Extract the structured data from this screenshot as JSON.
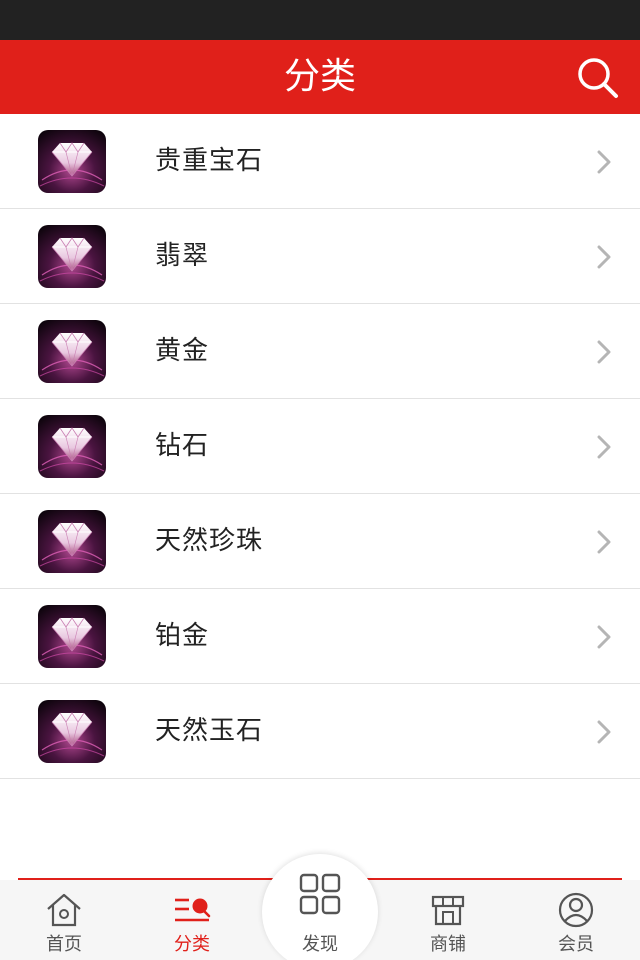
{
  "header": {
    "title": "分类",
    "search_icon": "search-icon"
  },
  "categories": [
    {
      "label": "贵重宝石"
    },
    {
      "label": "翡翠"
    },
    {
      "label": "黄金"
    },
    {
      "label": "钻石"
    },
    {
      "label": "天然珍珠"
    },
    {
      "label": "铂金"
    },
    {
      "label": "天然玉石"
    }
  ],
  "tabbar": {
    "home": {
      "label": "首页",
      "icon": "home-icon"
    },
    "category": {
      "label": "分类",
      "icon": "category-icon",
      "active": true
    },
    "discover": {
      "label": "发现",
      "icon": "grid-icon"
    },
    "shop": {
      "label": "商铺",
      "icon": "store-icon"
    },
    "member": {
      "label": "会员",
      "icon": "user-icon"
    }
  },
  "colors": {
    "accent": "#e0201a",
    "statusbar": "#222222"
  }
}
